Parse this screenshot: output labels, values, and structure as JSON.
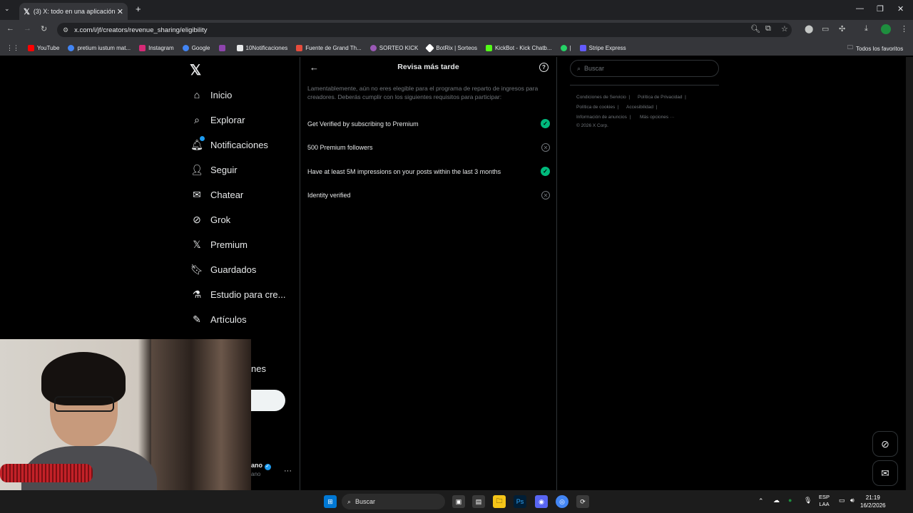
{
  "browser": {
    "tab_title": "(3) X: todo en una aplicación / X",
    "url": "x.com/i/jf/creators/revenue_sharing/eligibility",
    "bookmarks": [
      {
        "label": "YouTube",
        "color": "#ff0000"
      },
      {
        "label": "pretium iustum mat...",
        "color": "#4285f4"
      },
      {
        "label": "Instagram",
        "color": "#d62976"
      },
      {
        "label": "Google",
        "color": "#4285f4"
      },
      {
        "label": "",
        "color": "#8e44ad"
      },
      {
        "label": "10Notificaciones",
        "color": "#e7e9ea"
      },
      {
        "label": "Fuente de Grand Th...",
        "color": "#e74c3c"
      },
      {
        "label": "SORTEO KICK",
        "color": "#9b59b6"
      },
      {
        "label": "BotRix | Sorteos",
        "color": "#ffffff"
      },
      {
        "label": "KickBot - Kick Chatb...",
        "color": "#53fc18"
      },
      {
        "label": "",
        "color": "#25d366"
      },
      {
        "label": "Stripe Express",
        "color": "#635bff"
      }
    ],
    "all_bookmarks_label": "Todos los favoritos"
  },
  "nav": {
    "items": [
      {
        "label": "Inicio",
        "icon": "home-icon"
      },
      {
        "label": "Explorar",
        "icon": "search-icon"
      },
      {
        "label": "Notificaciones",
        "icon": "bell-icon"
      },
      {
        "label": "Seguir",
        "icon": "follow-icon"
      },
      {
        "label": "Chatear",
        "icon": "mail-icon"
      },
      {
        "label": "Grok",
        "icon": "grok-icon"
      },
      {
        "label": "Premium",
        "icon": "x-icon"
      },
      {
        "label": "Guardados",
        "icon": "bookmark-icon"
      },
      {
        "label": "Estudio para cre...",
        "icon": "flask-icon"
      },
      {
        "label": "Artículos",
        "icon": "article-icon"
      }
    ],
    "partial_label": "nes",
    "profile_name_tail": "ano",
    "profile_handle_tail": "ano"
  },
  "main": {
    "title": "Revisa más tarde",
    "intro": "Lamentablemente, aún no eres elegible para el programa de reparto de ingresos para creadores. Deberás cumplir con los siguientes requisitos para participar:",
    "requirements": [
      {
        "label": "Get Verified by subscribing to Premium",
        "met": true
      },
      {
        "label": "500 Premium followers",
        "met": false
      },
      {
        "label": "Have at least 5M impressions on your posts within the last 3 months",
        "met": true
      },
      {
        "label": "Identity verified",
        "met": false
      }
    ]
  },
  "right": {
    "search_placeholder": "Buscar",
    "footer": {
      "terms": "Condiciones de Servicio",
      "privacy": "Política de Privacidad",
      "cookies": "Política de cookies",
      "accessibility": "Accesibilidad",
      "ads": "Información de anuncios",
      "more": "Más opciones ···",
      "copyright": "© 2026 X Corp."
    }
  },
  "taskbar": {
    "search_label": "Buscar",
    "lang_line1": "ESP",
    "lang_line2": "LAA",
    "time": "21:19",
    "date": "16/2/2026"
  },
  "colors": {
    "verified_green": "#00ba7c",
    "text_secondary": "#71767b",
    "border": "#2f3336"
  }
}
